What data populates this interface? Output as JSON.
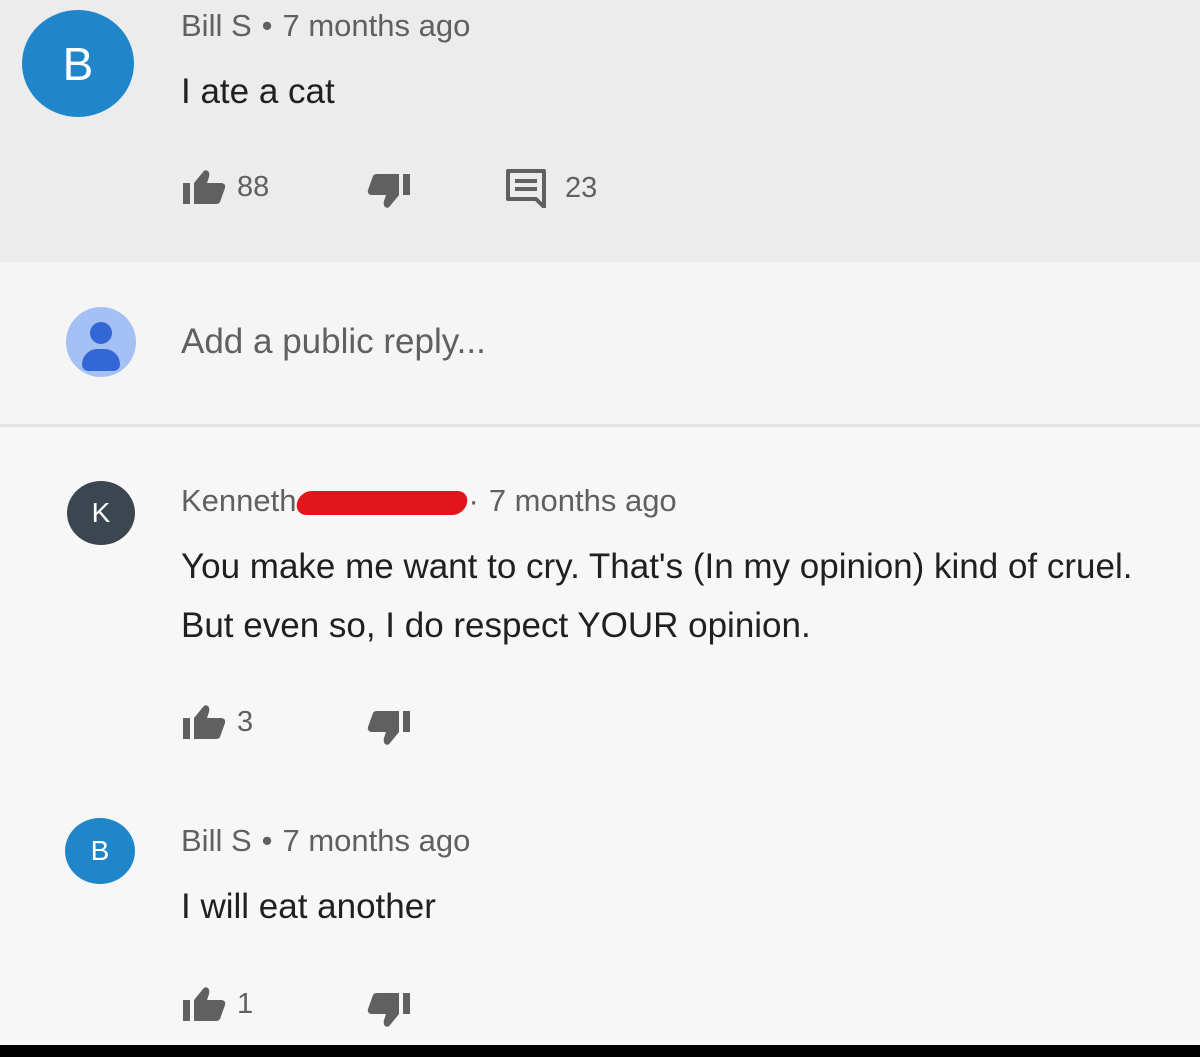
{
  "comment": {
    "avatar_letter": "B",
    "author": "Bill S",
    "separator": "•",
    "time": "7 months ago",
    "text": "I ate a cat",
    "likes": "88",
    "replies_count": "23"
  },
  "reply_box": {
    "placeholder": "Add a public reply..."
  },
  "replies": [
    {
      "avatar_letter": "K",
      "author": "Kenneth",
      "separator": "·",
      "time": "7 months ago",
      "text": "You make me want to cry. That's (In my opinion) kind of cruel. But even so, I do respect YOUR opinion.",
      "likes": "3"
    },
    {
      "avatar_letter": "B",
      "author": "Bill S",
      "separator": "•",
      "time": "7 months ago",
      "text": "I will eat another",
      "likes": "1"
    }
  ],
  "colors": {
    "avatar_blue": "#1f86c9",
    "avatar_dark": "#3c4650",
    "redaction": "#e2141c"
  },
  "icons": [
    "thumbs-up-icon",
    "thumbs-down-icon",
    "comment-icon",
    "default-user-icon"
  ]
}
